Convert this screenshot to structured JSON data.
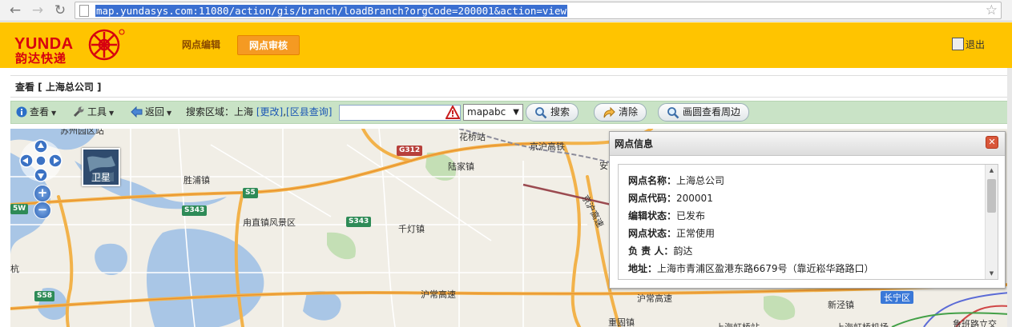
{
  "browser": {
    "back_icon": "arrow-left-icon",
    "forward_icon": "arrow-right-icon",
    "reload_icon": "reload-icon",
    "url": "map.yundasys.com:11080/action/gis/branch/loadBranch?orgCode=200001&action=view",
    "bookmark_icon": "star-icon"
  },
  "header": {
    "logo_en": "YUNDA",
    "logo_cn": "韵达快递",
    "menu": [
      {
        "label": "网点编辑"
      },
      {
        "label": "网点审核"
      }
    ],
    "logout_label": "退出",
    "colors": {
      "header_bg": "#ffc400",
      "brand_red": "#d7000f",
      "active_menu": "#f59a22"
    }
  },
  "panel": {
    "title": "查看 [ 上海总公司 ]"
  },
  "toolbar": {
    "view_label": "查看",
    "tools_label": "工具",
    "back_label": "返回",
    "search_area_label": "搜索区域：上海",
    "change_link": "[更改]",
    "comma": ",",
    "district_link": "[区县查询]",
    "search_value": "",
    "provider_value": "mapabc",
    "search_btn": "搜索",
    "clear_btn": "清除",
    "circle_btn": "画圆查看周边"
  },
  "map": {
    "satellite_label": "卫星",
    "zoom_in": "+",
    "zoom_out": "−",
    "labels": {
      "huaqiao": "花桥站",
      "jinghu_gaosu": "京沪高铁",
      "an": "安",
      "shengpu": "胜浦镇",
      "lujia": "陆家镇",
      "luzhi": "甪直镇风景区",
      "qiandeng": "千灯镇",
      "jinghu": "京沪高速",
      "huchang1": "沪常高速",
      "huchang2": "沪常高速",
      "chonggu": "重固镇",
      "xinjing": "新泾镇",
      "changning": "长宁区",
      "top_left": "苏州园区站",
      "kang": "杭",
      "road1": "上海虹桥站",
      "road2": "上海虹桥机场",
      "lubei": "鲁班路立交"
    },
    "shields": {
      "g312": "G312",
      "s5": "S5",
      "s343a": "S343",
      "s343b": "S343",
      "s58": "S58",
      "w5": "5W"
    }
  },
  "popup": {
    "title": "网点信息",
    "rows": [
      {
        "key": "网点名称：",
        "value": "上海总公司"
      },
      {
        "key": "网点代码：",
        "value": "200001"
      },
      {
        "key": "编辑状态：",
        "value": "已发布"
      },
      {
        "key": "网点状态：",
        "value": "正常使用"
      },
      {
        "key": "负 责 人：",
        "value": "韵达"
      },
      {
        "key": "地址：",
        "value": "上海市青浦区盈港东路6679号（靠近崧华路路口）"
      }
    ]
  }
}
